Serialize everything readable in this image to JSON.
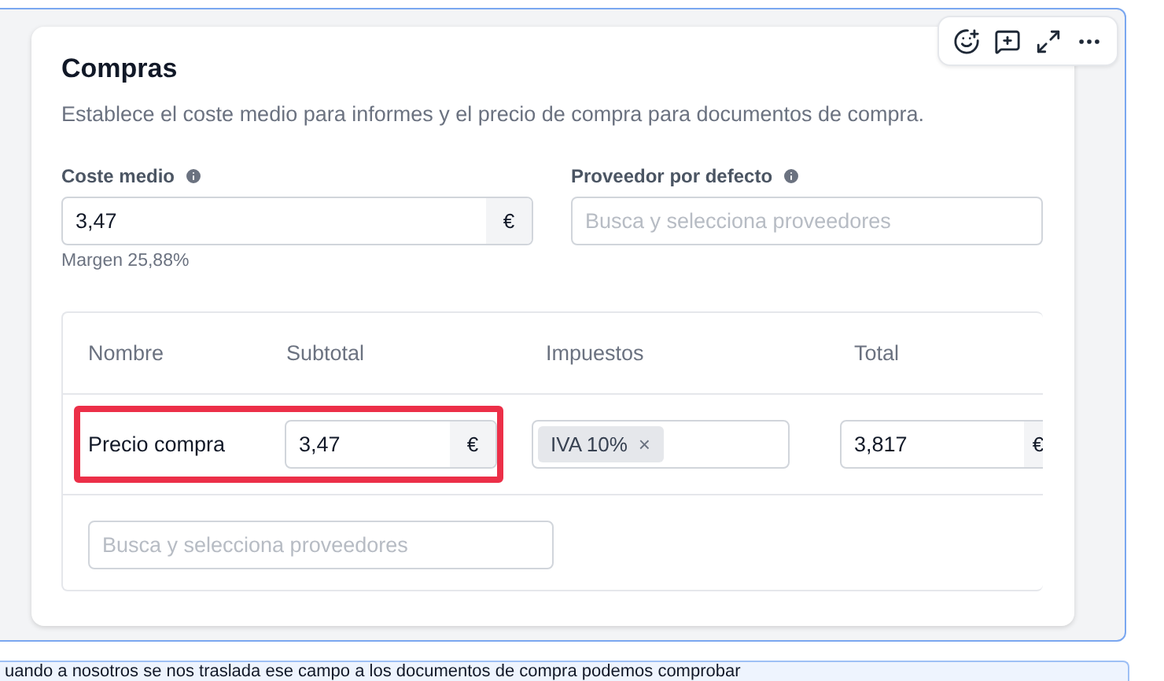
{
  "title": "Compras",
  "description": "Establece el coste medio para informes y el precio de compra para documentos de compra.",
  "fields": [
    {
      "label": "Coste medio",
      "value": "3,47",
      "suffix": "€",
      "hint": "Margen 25,88%"
    },
    {
      "label": "Proveedor por defecto",
      "placeholder": "Busca y selecciona proveedores"
    }
  ],
  "table": {
    "columns": [
      "Nombre",
      "Subtotal",
      "Impuestos",
      "Total"
    ],
    "rows": [
      {
        "name": "Precio compra",
        "highlighted": true,
        "subtotal": {
          "value": "3,47",
          "suffix": "€"
        },
        "taxes": [
          {
            "label": "IVA 10%",
            "remove": "×"
          }
        ],
        "total": {
          "value": "3,817",
          "suffix": "€"
        }
      }
    ],
    "supplier_search": {
      "placeholder": "Busca y selecciona proveedores"
    }
  },
  "note": "uando a nosotros se nos traslada ese campo a los documentos de compra podemos comprobar"
}
